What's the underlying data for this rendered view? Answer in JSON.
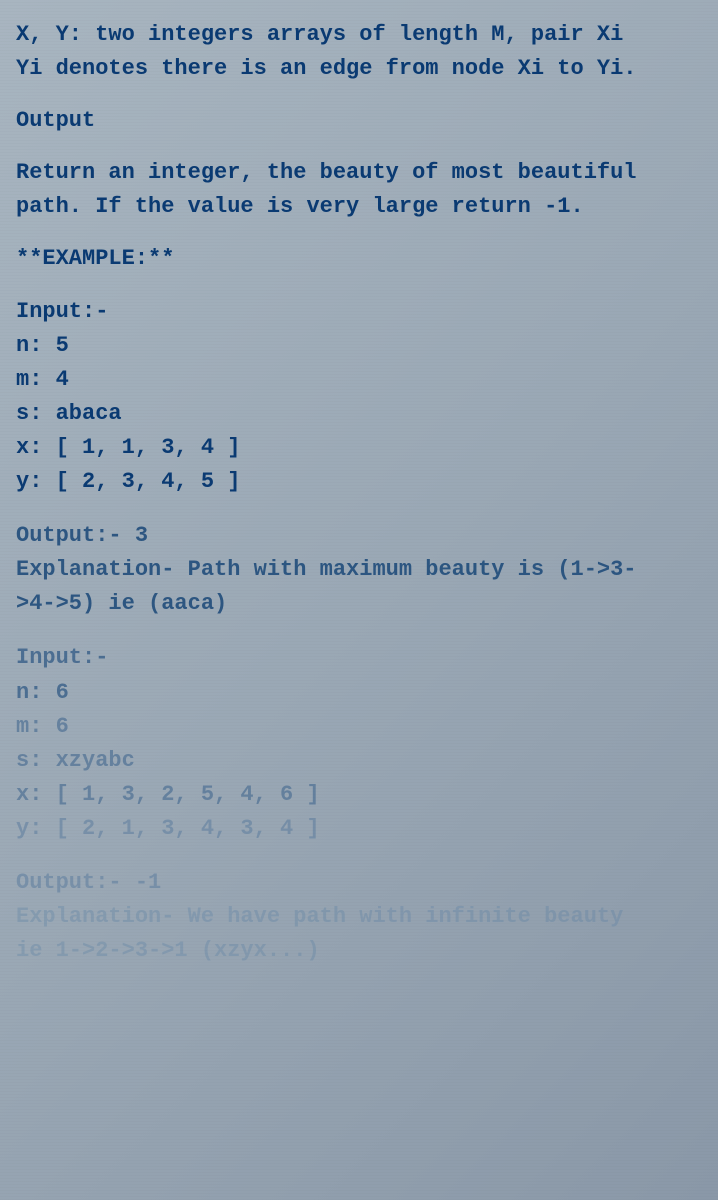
{
  "intro_line1": "X, Y: two integers arrays of length M, pair Xi ",
  "intro_line2": "Yi denotes there is an edge from node Xi to Yi.",
  "output_heading": "Output",
  "output_desc1": "Return an integer, the beauty of most beautiful",
  "output_desc2": "path. If the value is very large return -1.",
  "example_heading": "**EXAMPLE:**",
  "ex1": {
    "input_label": "Input:-",
    "n": "n: 5",
    "m": "m: 4",
    "s": "s: abaca",
    "x": "x: [ 1, 1, 3, 4 ]",
    "y": "y: [ 2, 3, 4, 5 ]",
    "output": "Output:- 3",
    "exp1": "Explanation- Path with maximum beauty is (1->3-",
    "exp2": ">4->5) ie (aaca)"
  },
  "ex2": {
    "input_label": "Input:-",
    "n": "n: 6",
    "m": "m: 6",
    "s": "s: xzyabc",
    "x": "x: [ 1, 3, 2, 5, 4, 6 ]",
    "y": "y: [ 2, 1, 3, 4, 3, 4 ]",
    "output": "Output:- -1",
    "exp1": "Explanation- We have path with infinite beauty",
    "exp2": "ie 1->2->3->1 (xzyx...)"
  }
}
